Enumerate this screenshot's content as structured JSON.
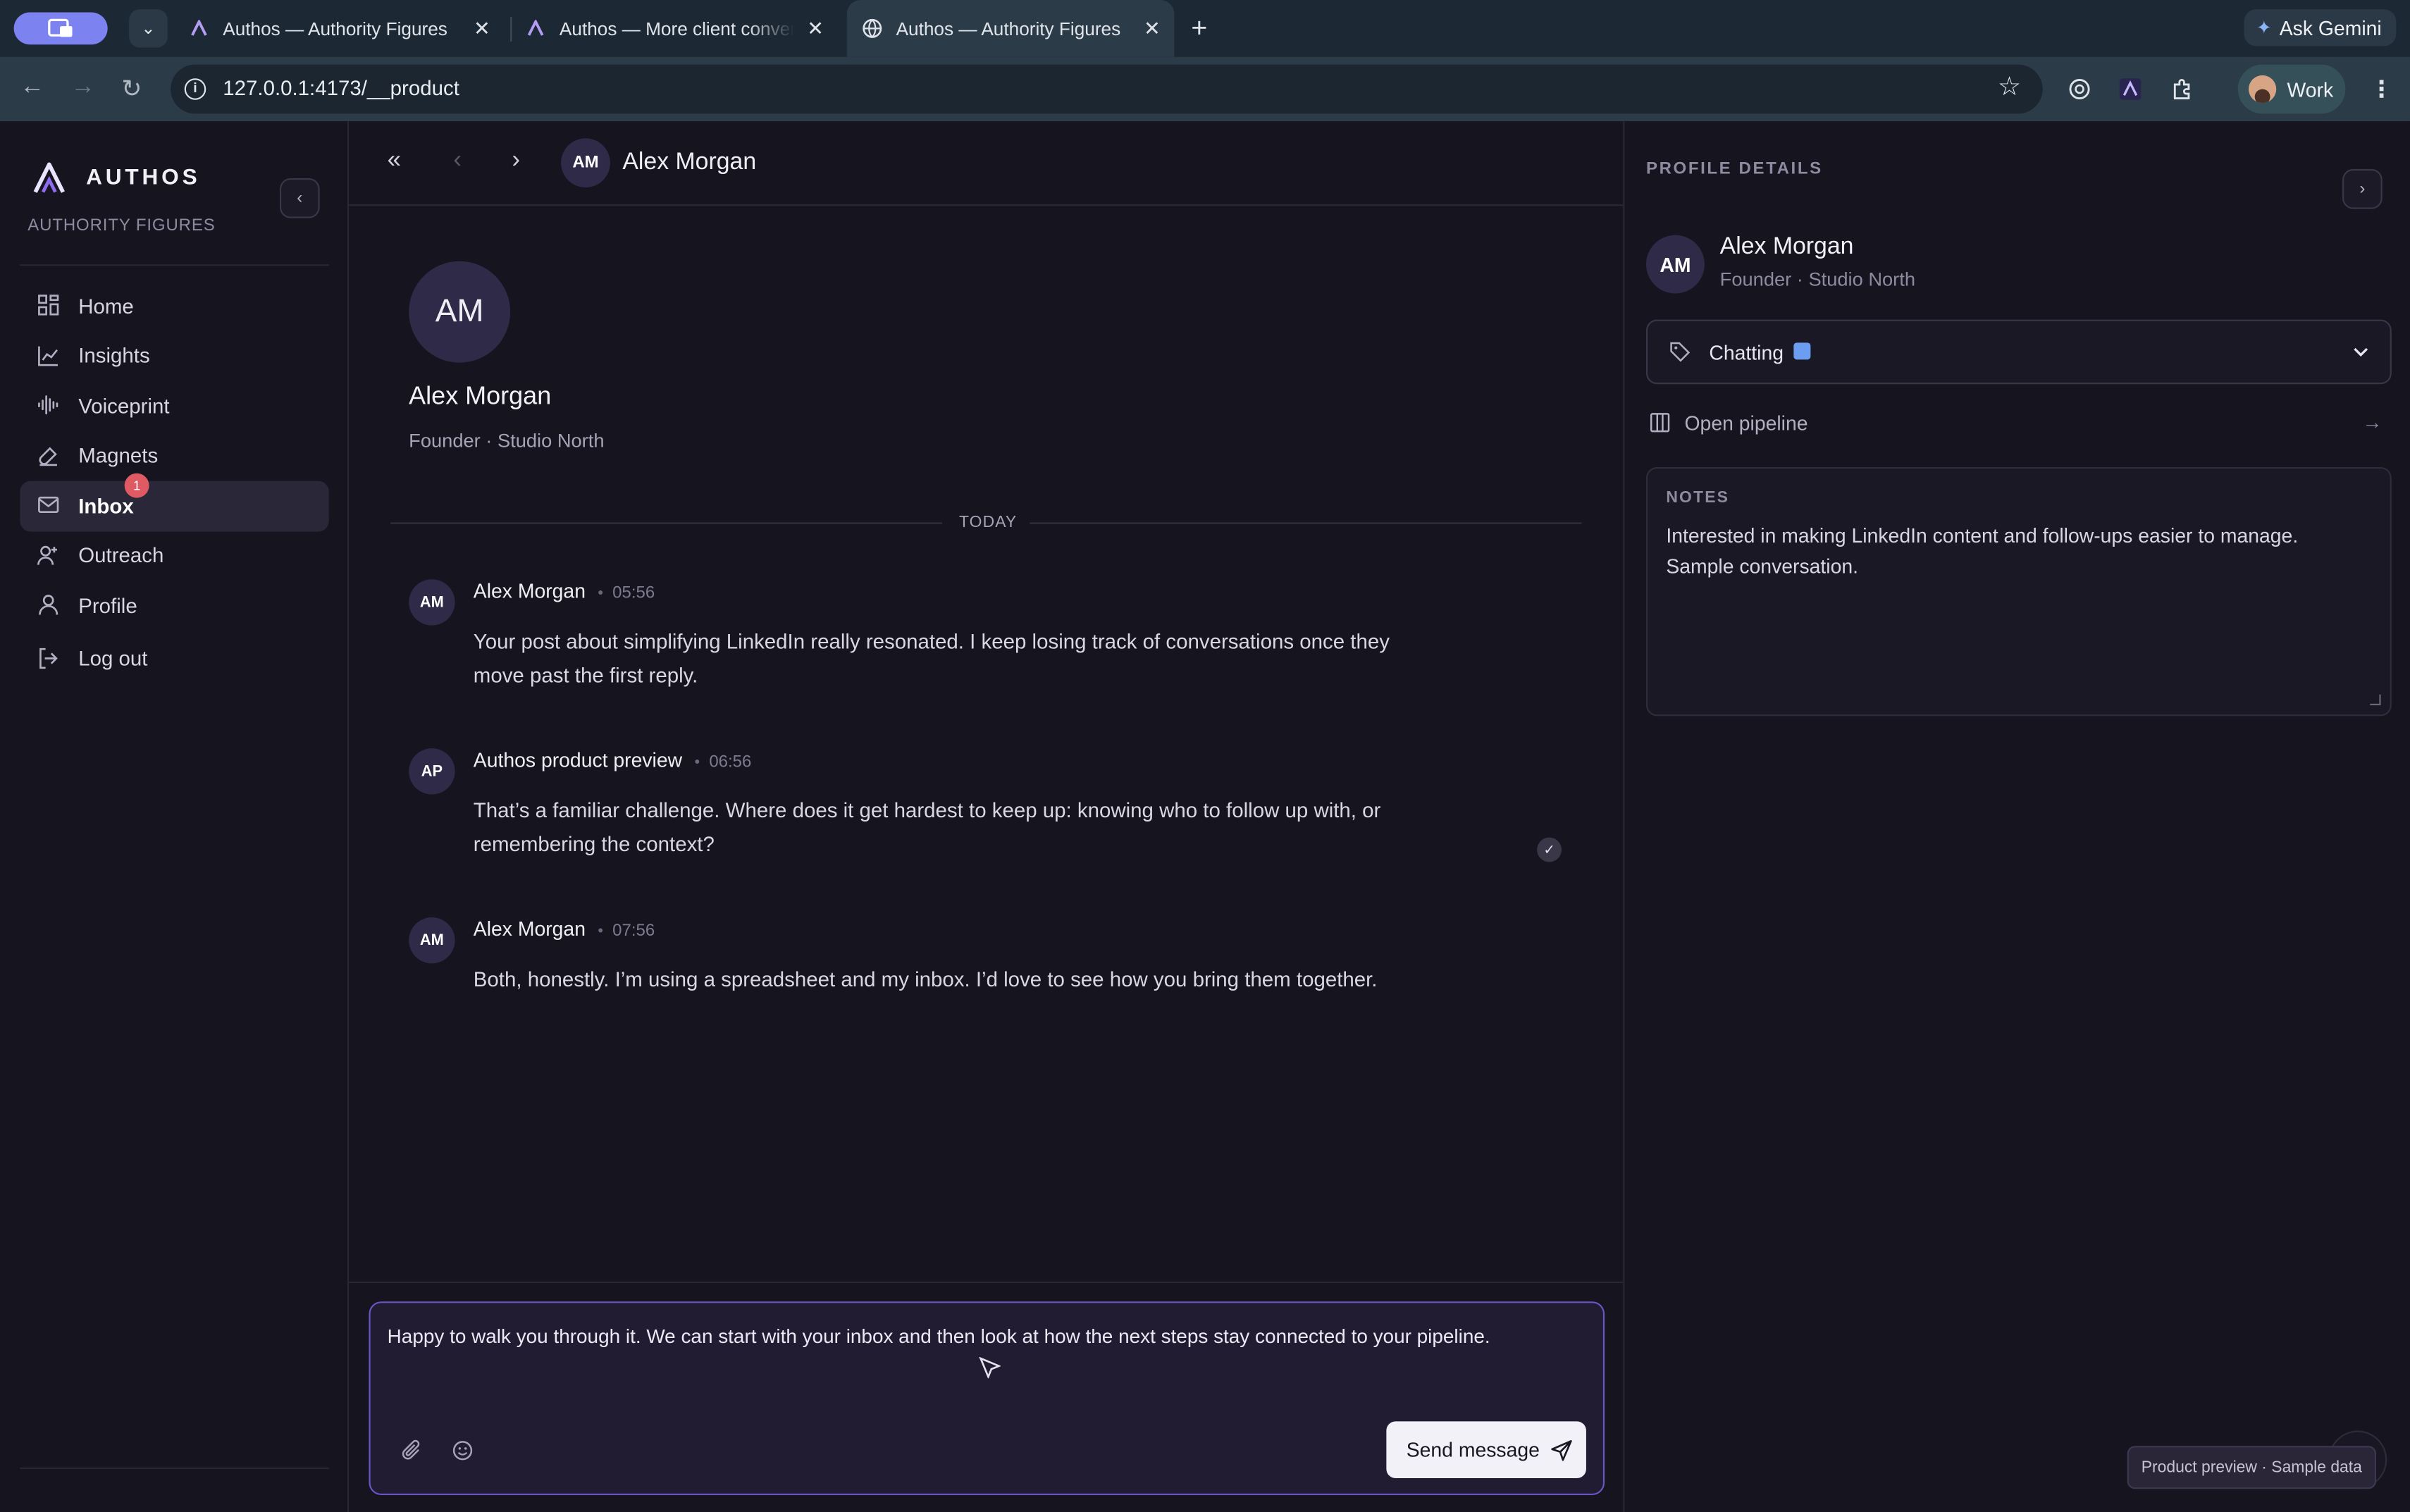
{
  "browser": {
    "tabs": [
      {
        "title": "Authos — Authority Figures"
      },
      {
        "title": "Authos — More client convers"
      },
      {
        "title": "Authos — Authority Figures"
      }
    ],
    "ask_label": "Ask Gemini",
    "url": "127.0.0.1:4173/__product",
    "profile_label": "Work"
  },
  "sidebar": {
    "brand": "AUTHOS",
    "workspace": "AUTHORITY FIGURES",
    "items": [
      {
        "label": "Home",
        "icon": "grid-icon"
      },
      {
        "label": "Insights",
        "icon": "chart-line-icon"
      },
      {
        "label": "Voiceprint",
        "icon": "waveform-icon"
      },
      {
        "label": "Magnets",
        "icon": "magnet-icon"
      },
      {
        "label": "Inbox",
        "icon": "mail-icon",
        "badge": "1",
        "active": true
      },
      {
        "label": "Outreach",
        "icon": "user-plus-icon"
      },
      {
        "label": "Profile",
        "icon": "user-icon"
      },
      {
        "label": "Log out",
        "icon": "logout-icon"
      }
    ]
  },
  "conversation": {
    "header_initials": "AM",
    "header_name": "Alex Morgan",
    "contact": {
      "initials": "AM",
      "name": "Alex Morgan",
      "role": "Founder · Studio North"
    },
    "day_label": "TODAY",
    "messages": [
      {
        "initials": "AM",
        "author": "Alex Morgan",
        "time": "05:56",
        "text": "Your post about simplifying LinkedIn really resonated. I keep losing track of conversations once they move past the first reply."
      },
      {
        "initials": "AP",
        "author": "Authos product preview",
        "time": "06:56",
        "text": "That’s a familiar challenge. Where does it get hardest to keep up: knowing who to follow up with, or remembering the context?",
        "read": true
      },
      {
        "initials": "AM",
        "author": "Alex Morgan",
        "time": "07:56",
        "text": "Both, honestly. I’m using a spreadsheet and my inbox. I’d love to see how you bring them together."
      }
    ],
    "composer_text": "Happy to walk you through it. We can start with your inbox and then look at how the next steps stay connected to your pipeline.",
    "send_label": "Send message"
  },
  "profile": {
    "section_title": "PROFILE DETAILS",
    "initials": "AM",
    "name": "Alex Morgan",
    "role": "Founder · Studio North",
    "status": "Chatting",
    "status_color": "#6b9ef0",
    "pipeline_label": "Open pipeline",
    "notes_label": "NOTES",
    "notes_text": "Interested in making LinkedIn content and follow-ups easier to manage.\nSample conversation.",
    "preview_badge": "Product preview · Sample data"
  },
  "colors": {
    "accent": "#6a55c6",
    "badge": "#e05a64",
    "avatar": "#2f2a48"
  }
}
